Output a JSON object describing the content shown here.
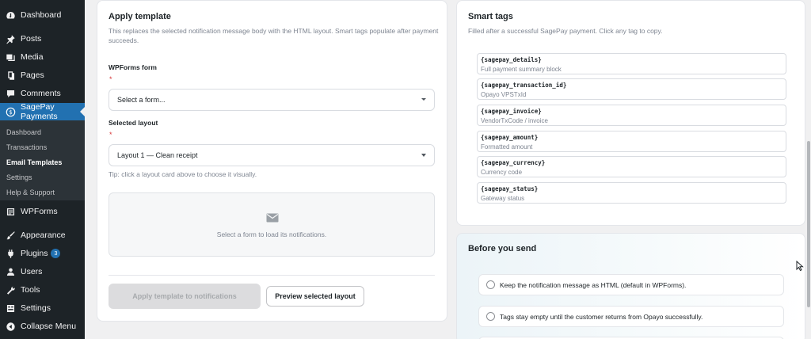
{
  "sidebar": {
    "top_items": [
      {
        "label": "Dashboard",
        "icon": "dashboard-icon"
      },
      {
        "label": "Posts",
        "icon": "pin-icon"
      },
      {
        "label": "Media",
        "icon": "media-icon"
      },
      {
        "label": "Pages",
        "icon": "pages-icon"
      },
      {
        "label": "Comments",
        "icon": "comments-icon"
      },
      {
        "label": "SagePay Payments",
        "icon": "dollar-icon"
      }
    ],
    "submenu": [
      "Dashboard",
      "Transactions",
      "Email Templates",
      "Settings",
      "Help & Support"
    ],
    "bottom_items": [
      {
        "label": "WPForms",
        "icon": "wpforms-icon"
      },
      {
        "label": "Appearance",
        "icon": "brush-icon"
      },
      {
        "label": "Plugins",
        "icon": "plugin-icon",
        "badge": "3"
      },
      {
        "label": "Users",
        "icon": "users-icon"
      },
      {
        "label": "Tools",
        "icon": "wrench-icon"
      },
      {
        "label": "Settings",
        "icon": "settings-icon"
      },
      {
        "label": "Collapse Menu",
        "icon": "collapse-icon"
      }
    ]
  },
  "apply_template": {
    "title": "Apply template",
    "description": "This replaces the selected notification message body with the HTML layout. Smart tags populate after payment succeeds.",
    "form_label": "WPForms form",
    "required_mark": "*",
    "form_select_value": "Select a form...",
    "layout_label": "Selected layout",
    "layout_select_value": "Layout 1 — Clean receipt",
    "tip": "Tip: click a layout card above to choose it visually.",
    "empty_state": "Select a form to load its notifications.",
    "apply_button": "Apply template to notifications",
    "preview_button": "Preview selected layout"
  },
  "smart_tags": {
    "title": "Smart tags",
    "description": "Filled after a successful SagePay payment. Click any tag to copy.",
    "tags": [
      {
        "code": "{sagepay_details}",
        "desc": "Full payment summary block"
      },
      {
        "code": "{sagepay_transaction_id}",
        "desc": "Opayo VPSTxId"
      },
      {
        "code": "{sagepay_invoice}",
        "desc": "VendorTxCode / invoice"
      },
      {
        "code": "{sagepay_amount}",
        "desc": "Formatted amount"
      },
      {
        "code": "{sagepay_currency}",
        "desc": "Currency code"
      },
      {
        "code": "{sagepay_status}",
        "desc": "Gateway status"
      }
    ]
  },
  "before_send": {
    "title": "Before you send",
    "items": [
      "Keep the notification message as HTML (default in WPForms).",
      "Tags stay empty until the customer returns from Opayo successfully."
    ]
  },
  "colors": {
    "sidebar_bg": "#1d2327",
    "accent": "#2271b1",
    "required": "#d63638"
  }
}
